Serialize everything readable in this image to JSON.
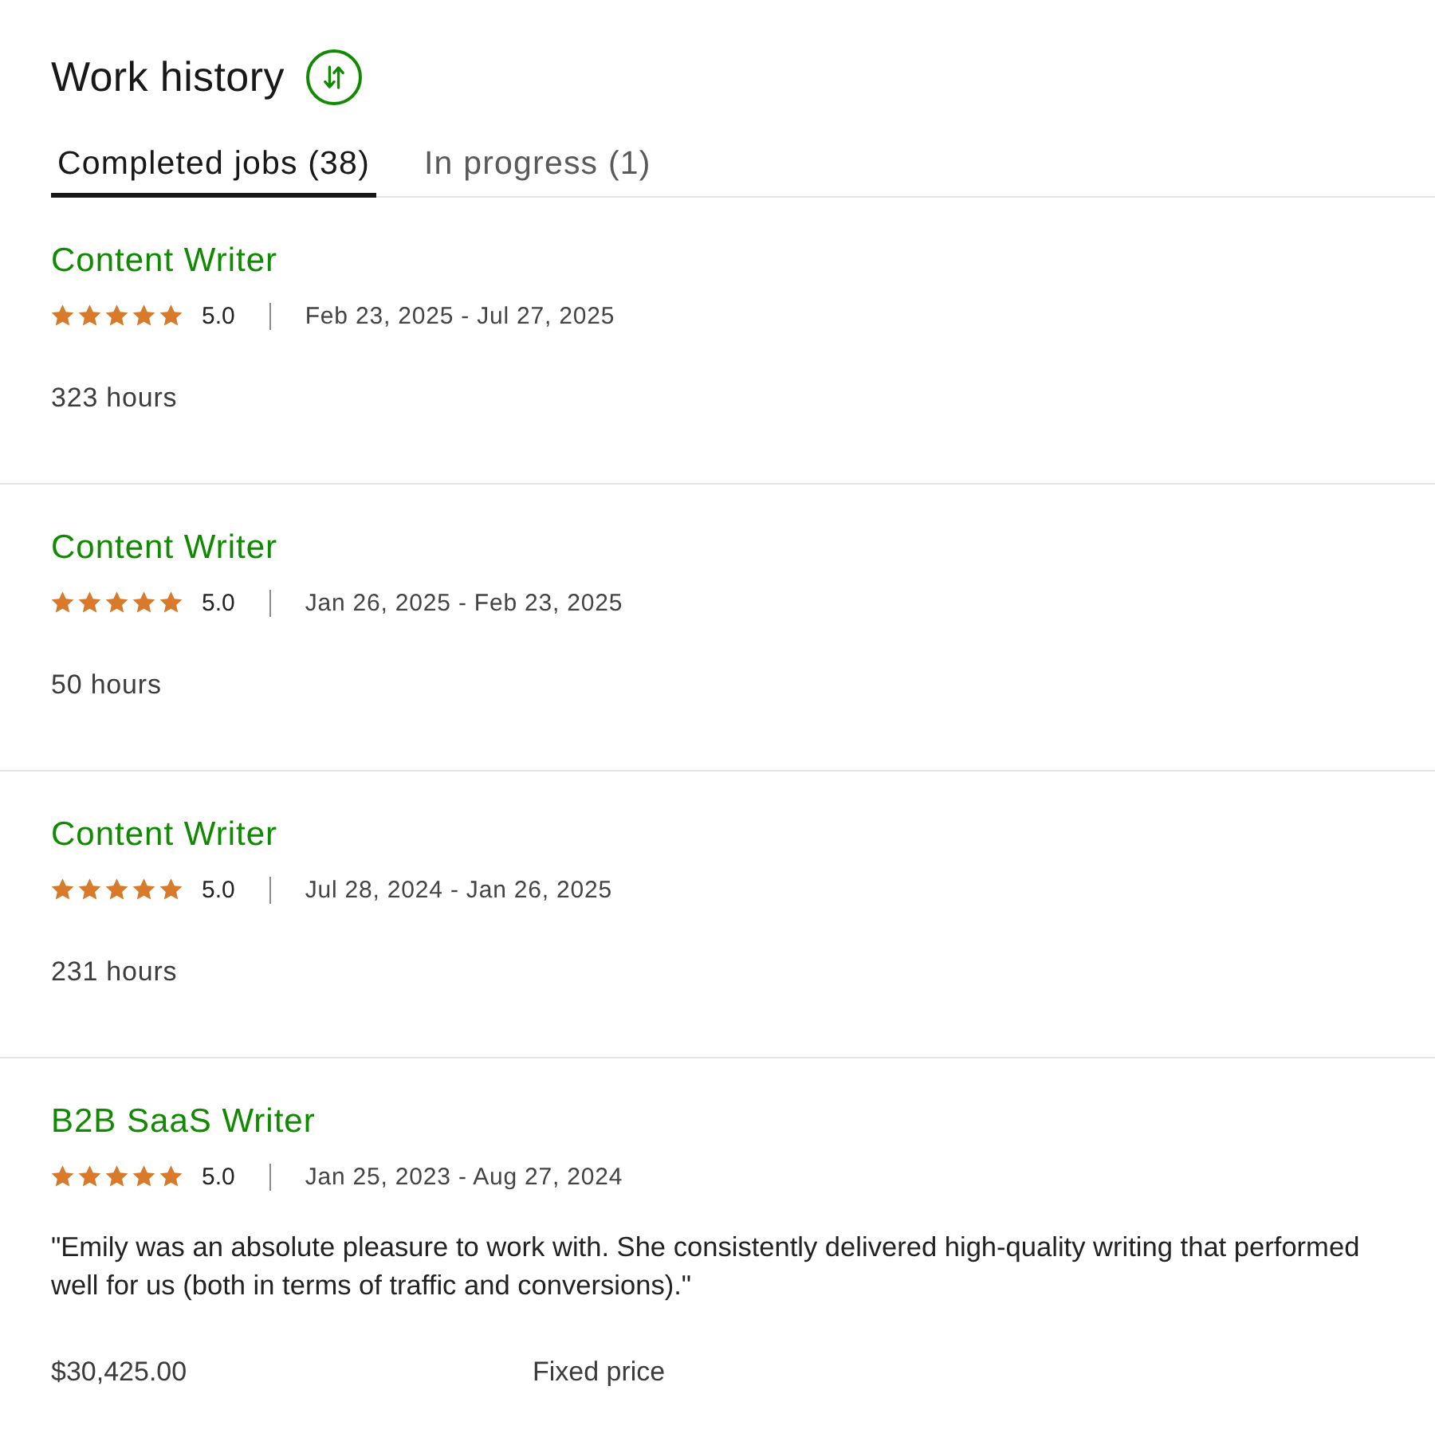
{
  "header": {
    "title": "Work history"
  },
  "tabs": [
    {
      "label": "Completed jobs (38)",
      "selected": true
    },
    {
      "label": "In progress (1)",
      "selected": false
    }
  ],
  "jobs": [
    {
      "kind": "hours",
      "title": "Content Writer",
      "stars": 5,
      "rating": "5.0",
      "dates": "Feb 23, 2025 - Jul 27, 2025",
      "hours": "323 hours"
    },
    {
      "kind": "hours",
      "title": "Content Writer",
      "stars": 5,
      "rating": "5.0",
      "dates": "Jan 26, 2025 - Feb 23, 2025",
      "hours": "50 hours"
    },
    {
      "kind": "hours",
      "title": "Content Writer",
      "stars": 5,
      "rating": "5.0",
      "dates": "Jul 28, 2024 - Jan 26, 2025",
      "hours": "231 hours"
    },
    {
      "kind": "fixed",
      "title": "B2B SaaS Writer",
      "stars": 5,
      "rating": "5.0",
      "dates": "Jan 25, 2023 - Aug 27, 2024",
      "feedback": "\"Emily was an absolute pleasure to work with. She consistently delivered high-quality writing that performed well for us (both in terms of traffic and conversions).\"",
      "amount": "$30,425.00",
      "price_type": "Fixed price"
    }
  ]
}
